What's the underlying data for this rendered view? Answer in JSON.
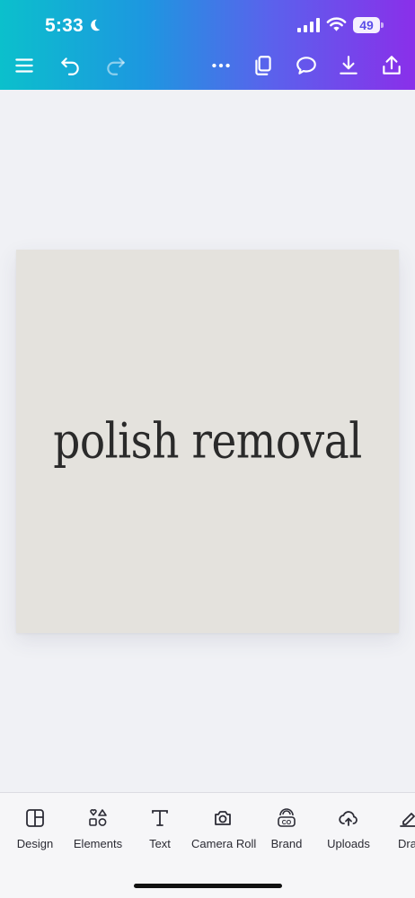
{
  "status_bar": {
    "time": "5:33",
    "battery": "49",
    "icons": [
      "moon-icon",
      "cellular-signal-icon",
      "wifi-icon",
      "battery-icon"
    ]
  },
  "toolbar": {
    "left": [
      "menu-icon",
      "undo-icon",
      "redo-icon"
    ],
    "right": [
      "more-icon",
      "pages-icon",
      "comment-icon",
      "download-icon",
      "share-icon"
    ]
  },
  "canvas": {
    "text": "polish removal",
    "background_color": "#e4e2dd",
    "text_color": "#2a2a2a"
  },
  "bottom_tools": [
    {
      "label": "Design",
      "icon": "design-icon"
    },
    {
      "label": "Elements",
      "icon": "elements-icon"
    },
    {
      "label": "Text",
      "icon": "text-icon"
    },
    {
      "label": "Camera Roll",
      "icon": "camera-icon"
    },
    {
      "label": "Brand",
      "icon": "brand-icon"
    },
    {
      "label": "Uploads",
      "icon": "upload-cloud-icon"
    },
    {
      "label": "Dra",
      "icon": "draw-icon"
    }
  ],
  "colors": {
    "gradient": [
      "#0bc0cc",
      "#1d97e0",
      "#5a62ec",
      "#8a2fea"
    ],
    "app_background": "#f0f1f5"
  }
}
